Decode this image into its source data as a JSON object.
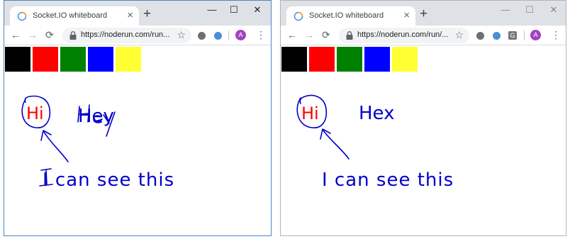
{
  "windows": [
    {
      "id": "left",
      "tab": {
        "title": "Socket.IO whiteboard",
        "close": "×"
      },
      "new_tab": "+",
      "controls": {
        "minimize": "—",
        "maximize": "☐",
        "close": "✕"
      },
      "nav": {
        "back": "←",
        "forward": "→",
        "reload": "⟳"
      },
      "url": "https://noderun.com/run...",
      "star": "☆",
      "avatar_letter": "A",
      "menu": "⋮",
      "palette": [
        "#000000",
        "#ff0000",
        "#008000",
        "#0000ff",
        "#ffff33"
      ],
      "drawing": {
        "circled_text": "Hi",
        "word": "Hey",
        "caption": "I can see this"
      }
    },
    {
      "id": "right",
      "tab": {
        "title": "Socket.IO whiteboard",
        "close": "×"
      },
      "new_tab": "+",
      "controls": {
        "minimize": "—",
        "maximize": "☐",
        "close": "✕"
      },
      "nav": {
        "back": "←",
        "forward": "→",
        "reload": "⟳"
      },
      "url": "https://noderun.com/run/...",
      "star": "☆",
      "extension_g": "G",
      "avatar_letter": "A",
      "menu": "⋮",
      "palette": [
        "#000000",
        "#ff0000",
        "#008000",
        "#0000ff",
        "#ffff33"
      ],
      "drawing": {
        "circled_text": "Hi",
        "word": "Hex",
        "caption": "I can see this"
      }
    }
  ]
}
